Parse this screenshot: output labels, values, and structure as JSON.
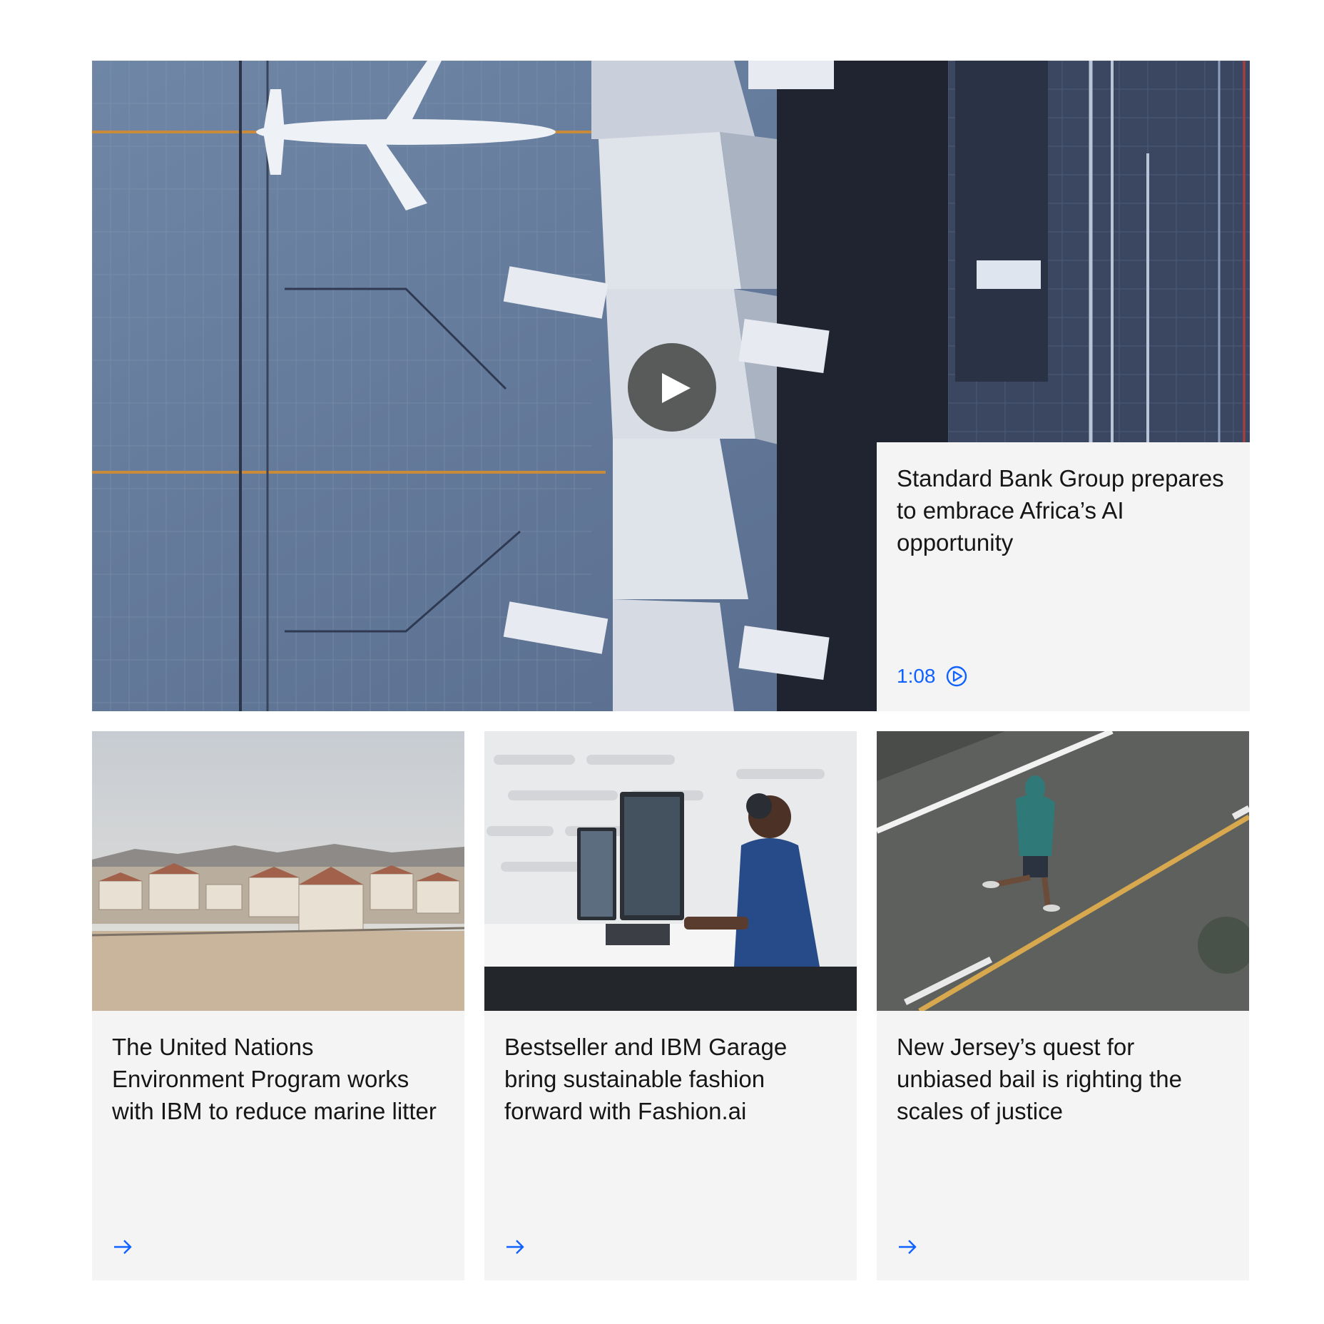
{
  "hero": {
    "image": "aerial-airport-terminal-photo",
    "title": "Standard Bank Group prepares to embrace Africa’s AI opportunity",
    "duration": "1:08",
    "play_icon": "play-icon",
    "duration_icon": "play-outline-circle-icon"
  },
  "cards": [
    {
      "image": "housing-development-desert-photo",
      "title": "The United Nations Environment Program works with IBM to reduce marine litter",
      "link_icon": "arrow-right-icon"
    },
    {
      "image": "developer-at-standing-desk-photo",
      "title": "Bestseller and IBM Garage bring sustainable fashion forward with Fashion.ai",
      "link_icon": "arrow-right-icon"
    },
    {
      "image": "runner-on-road-photo",
      "title": "New Jersey’s quest for unbiased bail is righting the scales of justice",
      "link_icon": "arrow-right-icon"
    }
  ],
  "colors": {
    "accent": "#0f62fe",
    "card_bg": "#f4f4f4",
    "text": "#161616"
  }
}
